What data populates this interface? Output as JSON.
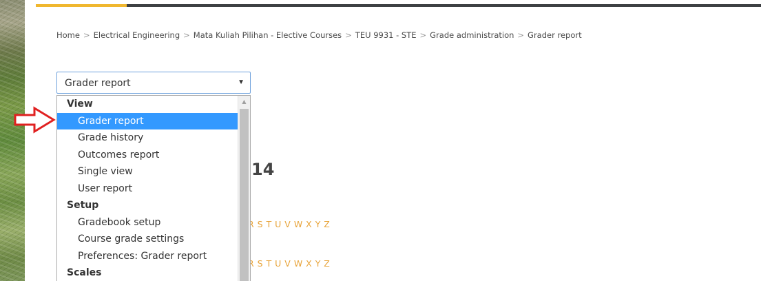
{
  "breadcrumb": [
    "Home",
    "Electrical Engineering",
    "Mata Kuliah Pilihan - Elective Courses",
    "TEU 9931 - STE",
    "Grade administration",
    "Grader report"
  ],
  "breadcrumb_separator": ">",
  "select": {
    "value": "Grader report",
    "caret": "▼"
  },
  "dropdown": {
    "groups": [
      {
        "label": "View",
        "items": [
          "Grader report",
          "Grade history",
          "Outcomes report",
          "Single view",
          "User report"
        ]
      },
      {
        "label": "Setup",
        "items": [
          "Gradebook setup",
          "Course grade settings",
          "Preferences: Grader report"
        ]
      },
      {
        "label": "Scales",
        "items": []
      }
    ],
    "selected": "Grader report"
  },
  "background": {
    "heading_fragment": "14",
    "alphabet_row_1": "R S T U V W X Y Z",
    "alphabet_row_2": "R S T U V W X Y Z"
  },
  "colors": {
    "accent": "#f0b72f",
    "topbar": "#3d4043",
    "selection": "#3399ff",
    "link": "#e8a43a",
    "annotation_arrow": "#e02020"
  },
  "icons": {
    "caret": "chevron-down-icon",
    "scroll_up": "scroll-up-icon",
    "annotation": "red-arrow-icon"
  }
}
